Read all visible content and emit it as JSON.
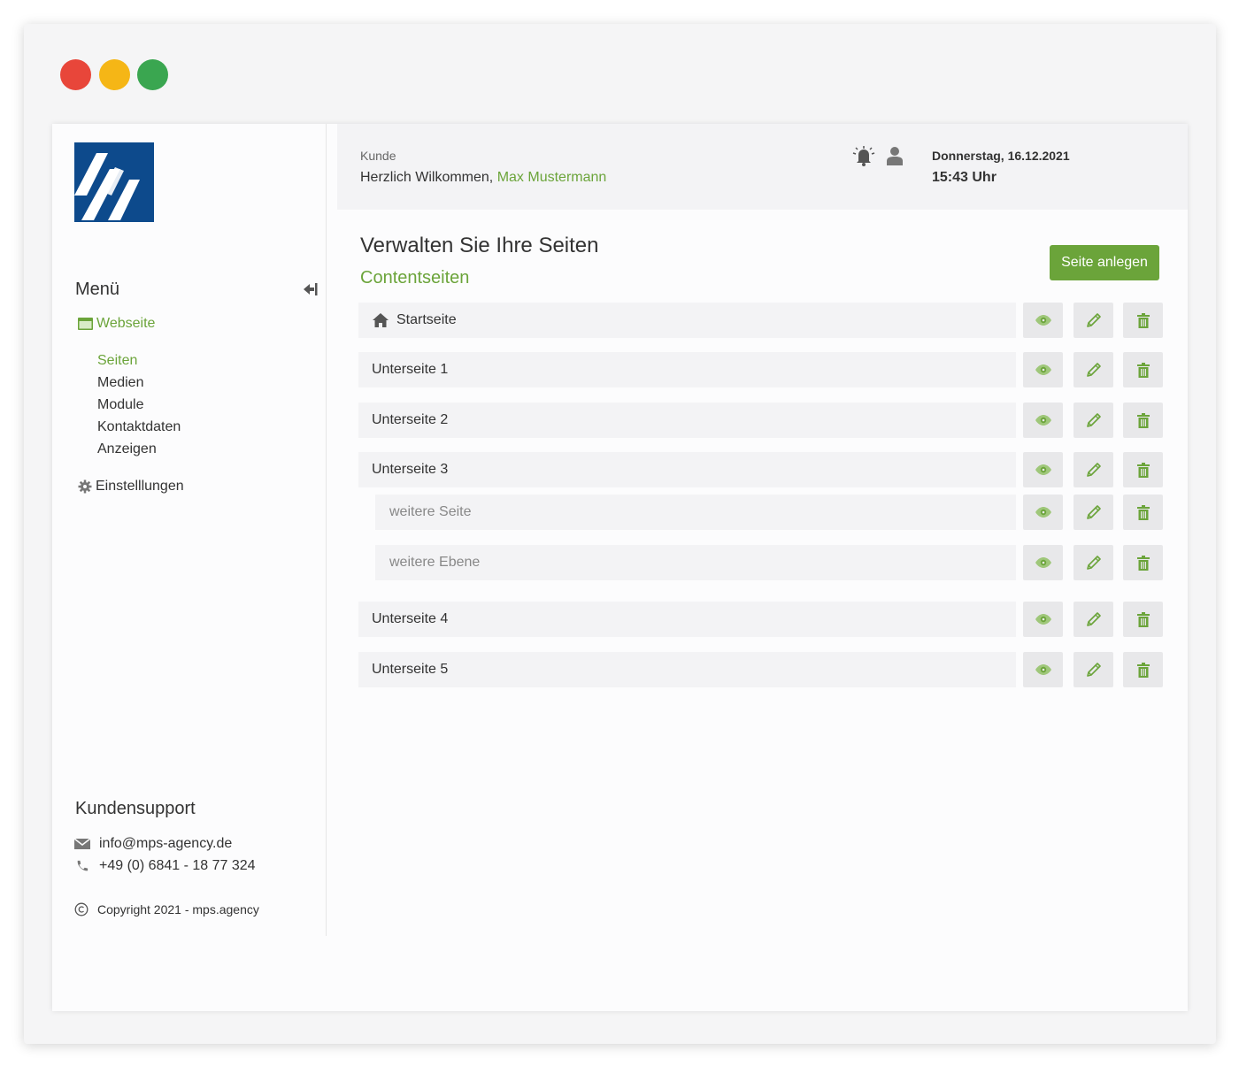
{
  "colors": {
    "accent": "#6ba43a",
    "logo_blue": "#0d4a8c",
    "traffic_red": "#e8463a",
    "traffic_yellow": "#f5b616",
    "traffic_green": "#3aa650"
  },
  "sidebar": {
    "menu_title": "Menü",
    "groups": [
      {
        "label": "Webseite",
        "icon": "browser-window-icon"
      },
      {
        "label": "Einstelllungen",
        "icon": "gear-icon"
      }
    ],
    "items": [
      {
        "label": "Seiten",
        "active": true
      },
      {
        "label": "Medien",
        "active": false
      },
      {
        "label": "Module",
        "active": false
      },
      {
        "label": "Kontaktdaten",
        "active": false
      },
      {
        "label": "Anzeigen",
        "active": false
      }
    ],
    "support_title": "Kundensupport",
    "email": "info@mps-agency.de",
    "phone": "+49 (0) 6841 - 18 77 324",
    "copyright": "Copyright 2021 - mps.agency"
  },
  "header": {
    "kunde_label": "Kunde",
    "welcome_prefix": "Herzlich Wilkommen,",
    "user_name": "Max Mustermann",
    "date": "Donnerstag, 16.12.2021",
    "time": "15:43 Uhr"
  },
  "main": {
    "title": "Verwalten Sie Ihre Seiten",
    "subtitle": "Contentseiten",
    "create_button": "Seite anlegen",
    "pages": [
      {
        "label": "Startseite",
        "level": 1,
        "icon": "house-icon"
      },
      {
        "label": "Unterseite 1",
        "level": 1
      },
      {
        "label": "Unterseite 2",
        "level": 1
      },
      {
        "label": "Unterseite 3",
        "level": 1
      },
      {
        "label": "weitere Seite",
        "level": 2
      },
      {
        "label": "weitere Ebene",
        "level": 2
      },
      {
        "label": "Unterseite 4",
        "level": 1
      },
      {
        "label": "Unterseite 5",
        "level": 1
      }
    ],
    "row_actions": [
      "eye-icon",
      "pencil-icon",
      "trash-icon"
    ]
  }
}
